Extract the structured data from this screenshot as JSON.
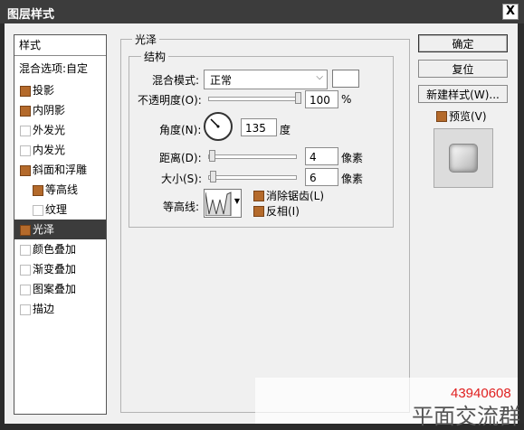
{
  "window": {
    "title": "图层样式",
    "close_label": "X"
  },
  "sidebar": {
    "header": "样式",
    "blend_options": "混合选项:自定",
    "items": [
      {
        "label": "投影",
        "checked": true
      },
      {
        "label": "内阴影",
        "checked": true
      },
      {
        "label": "外发光",
        "checked": false
      },
      {
        "label": "内发光",
        "checked": false
      },
      {
        "label": "斜面和浮雕",
        "checked": true
      },
      {
        "label": "等高线",
        "checked": true
      },
      {
        "label": "纹理",
        "checked": false
      },
      {
        "label": "光泽",
        "checked": true,
        "selected": true
      },
      {
        "label": "颜色叠加",
        "checked": false
      },
      {
        "label": "渐变叠加",
        "checked": false
      },
      {
        "label": "图案叠加",
        "checked": false
      },
      {
        "label": "描边",
        "checked": false
      }
    ]
  },
  "satin": {
    "section_title": "光泽",
    "structure_title": "结构",
    "blend_mode_label": "混合模式:",
    "blend_mode_value": "正常",
    "opacity_label": "不透明度(O):",
    "opacity_value": "100",
    "opacity_unit": "%",
    "opacity_fraction": 1.0,
    "angle_label": "角度(N):",
    "angle_value": "135",
    "angle_unit": "度",
    "distance_label": "距离(D):",
    "distance_value": "4",
    "distance_unit": "像素",
    "size_label": "大小(S):",
    "size_value": "6",
    "size_unit": "像素",
    "contour_label": "等高线:",
    "antialias_label": "消除锯齿(L)",
    "invert_label": "反相(I)"
  },
  "buttons": {
    "ok": "确定",
    "reset": "复位",
    "new_style": "新建样式(W)...",
    "preview_label": "预览(V)"
  },
  "watermark": {
    "number": "43940608",
    "text": "平面交流群"
  },
  "colors": {
    "checkbox_on": "#b46a2b",
    "selected_row": "#3c3c3c"
  }
}
